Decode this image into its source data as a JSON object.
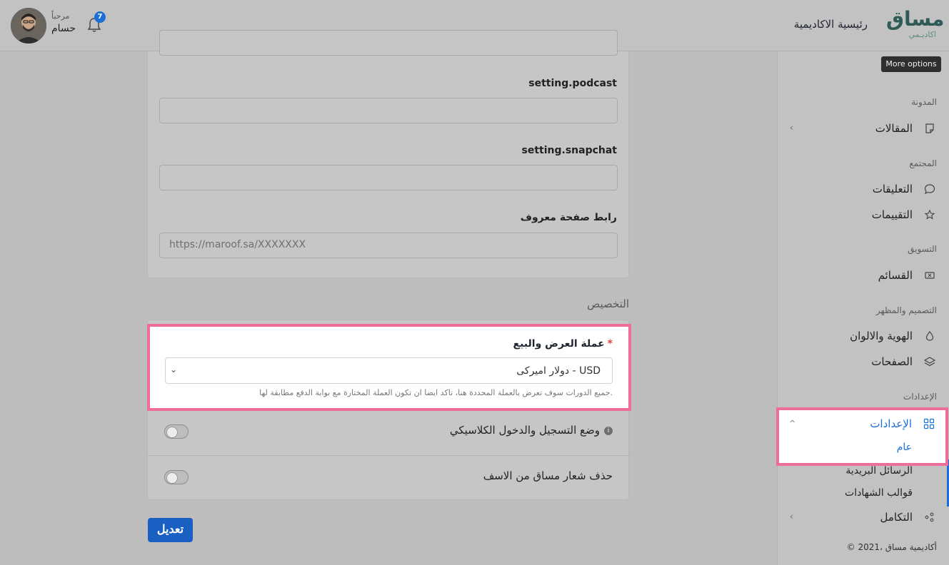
{
  "header": {
    "logo_main": "مساق",
    "logo_sub": "اكاديـمي",
    "home_link": "رئيسية الاكاديمية",
    "greeting": "مرحباً",
    "user_name": "حسام",
    "notifications_count": "7"
  },
  "tooltip": "More options",
  "sidebar": {
    "sections": {
      "blog": "المدونة",
      "community": "المجتمع",
      "marketing": "التسويق",
      "design": "التصميم والمظهر",
      "settings": "الإعدادات"
    },
    "items": {
      "articles": "المقالات",
      "comments": "التعليقات",
      "reviews": "التقييمات",
      "coupons": "القسائم",
      "identity": "الهوية والالوان",
      "pages": "الصفحات",
      "settings": "الإعدادات",
      "general": "عام",
      "mail": "الرسائل البريدية",
      "certificates": "قوالب الشهادات",
      "integration": "التكامل"
    },
    "copyright": "© 2021، أكاديمية مساق"
  },
  "form": {
    "podcast_label": "setting.podcast",
    "snapchat_label": "setting.snapchat",
    "maroof_label": "رابط صفحة معروف",
    "maroof_placeholder": "https://maroof.sa/XXXXXXX",
    "customization_title": "التخصيص",
    "currency_label": "عملة العرض والبيع",
    "currency_required": "*",
    "currency_value": "دولار امیرکی - USD",
    "currency_hint": "جميع الدورات سوف تعرض بالعملة المحددة هنا، تاكد ايضا ان تكون العملة المختارة مع بوابة الدفع مطابقة لها.",
    "classic_login_label": "وضع التسجيل والدخول الكلاسيكي",
    "remove_logo_label": "حذف شعار مساق من الاسف",
    "edit_button": "تعديل"
  }
}
